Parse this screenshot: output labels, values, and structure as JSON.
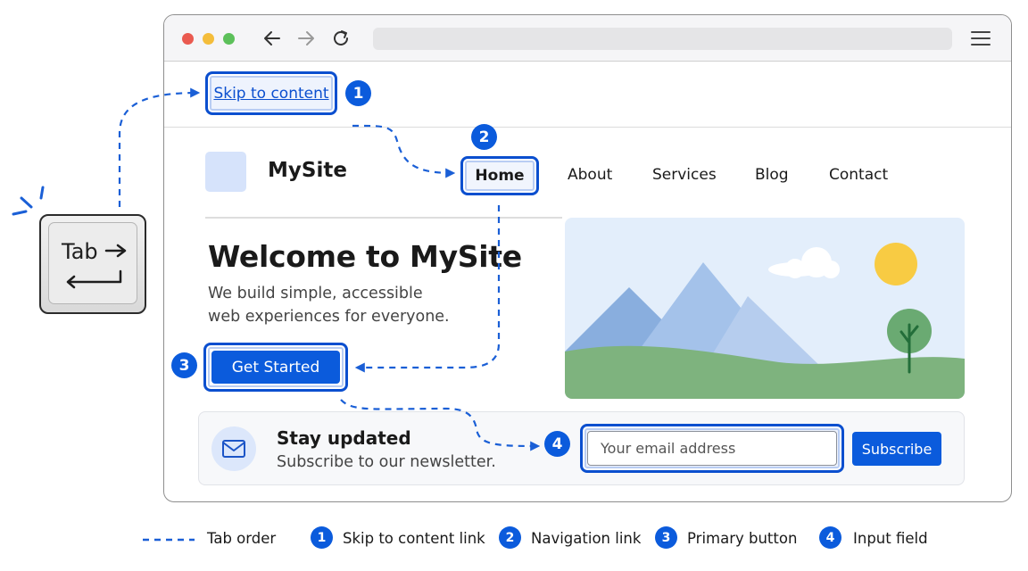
{
  "browser": {
    "window_controls": [
      "close-dot",
      "minimize-dot",
      "maximize-dot"
    ],
    "nav_icons": [
      "back-arrow-icon",
      "forward-arrow-icon",
      "reload-icon"
    ],
    "address_bar": "",
    "menu_icon": "hamburger-menu-icon"
  },
  "skip_link": {
    "label": "Skip to content",
    "badge": "1"
  },
  "site": {
    "name": "MySite",
    "nav": {
      "badge": "2",
      "items": [
        "Home",
        "About",
        "Services",
        "Blog",
        "Contact"
      ],
      "focused": "Home"
    },
    "hero": {
      "title": "Welcome to MySite",
      "subtitle_line1": "We build simple, accessible",
      "subtitle_line2": "web experiences for everyone.",
      "cta_label": "Get Started",
      "cta_badge": "3",
      "illustration": "landscape-illustration"
    },
    "newsletter": {
      "title": "Stay updated",
      "subtitle": "Subscribe to our newsletter.",
      "icon": "envelope-icon",
      "email_placeholder": "Your email address",
      "email_badge": "4",
      "button_label": "Subscribe"
    }
  },
  "keyboard_key": {
    "label": "Tab",
    "icon": "tab-arrows-icon"
  },
  "legend": {
    "tab_order": "Tab order",
    "items": [
      {
        "badge": "1",
        "label": "Skip to content link"
      },
      {
        "badge": "2",
        "label": "Navigation link"
      },
      {
        "badge": "3",
        "label": "Primary button"
      },
      {
        "badge": "4",
        "label": "Input field"
      }
    ]
  },
  "colors": {
    "focus_ring": "#0b4fcf",
    "accent": "#0b5bdc",
    "tab_order_path": "#1a5fd6"
  }
}
